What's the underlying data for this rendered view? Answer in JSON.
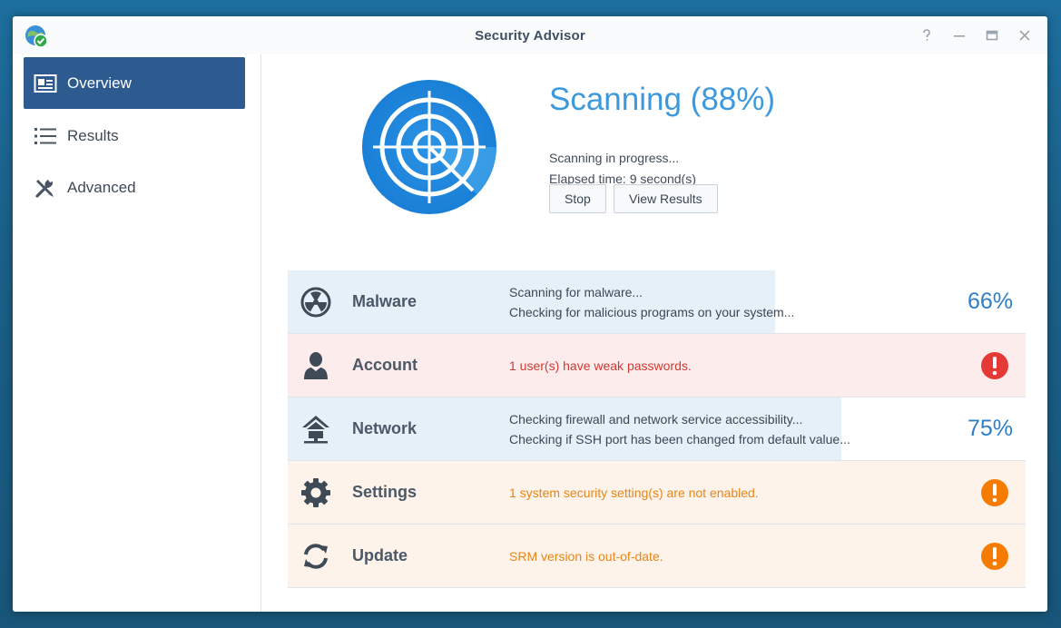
{
  "window": {
    "title": "Security Advisor"
  },
  "window_controls": [
    "help-icon",
    "minimize-icon",
    "maximize-icon",
    "close-icon"
  ],
  "sidebar": {
    "items": [
      {
        "label": "Overview",
        "icon": "overview-icon",
        "active": true
      },
      {
        "label": "Results",
        "icon": "list-icon",
        "active": false
      },
      {
        "label": "Advanced",
        "icon": "tools-icon",
        "active": false
      }
    ]
  },
  "scan": {
    "title": "Scanning (88%)",
    "progress_percent": 88,
    "status": "Scanning in progress...",
    "elapsed": "Elapsed time: 9 second(s)",
    "stop_label": "Stop",
    "view_results_label": "View Results"
  },
  "categories": [
    {
      "name": "Malware",
      "icon": "radiation-icon",
      "state": "scanning",
      "progress_percent": 66,
      "percent_text": "66%",
      "lines": [
        "Scanning for malware...",
        "Checking for malicious programs on your system..."
      ]
    },
    {
      "name": "Account",
      "icon": "user-icon",
      "state": "error",
      "lines": [
        "1 user(s) have weak passwords."
      ]
    },
    {
      "name": "Network",
      "icon": "home-network-icon",
      "state": "scanning",
      "progress_percent": 75,
      "percent_text": "75%",
      "lines": [
        "Checking firewall and network service accessibility...",
        "Checking if SSH port has been changed from default value..."
      ]
    },
    {
      "name": "Settings",
      "icon": "gear-icon",
      "state": "warning",
      "lines": [
        "1 system security setting(s) are not enabled."
      ]
    },
    {
      "name": "Update",
      "icon": "refresh-icon",
      "state": "warning",
      "lines": [
        "SRM version is out-of-date."
      ]
    }
  ],
  "colors": {
    "accent": "#3d99dd",
    "sidebar_active": "#2e5b8f",
    "error": "#e53935",
    "warning": "#f57c00",
    "progress_fill": "#e6f0f9"
  }
}
